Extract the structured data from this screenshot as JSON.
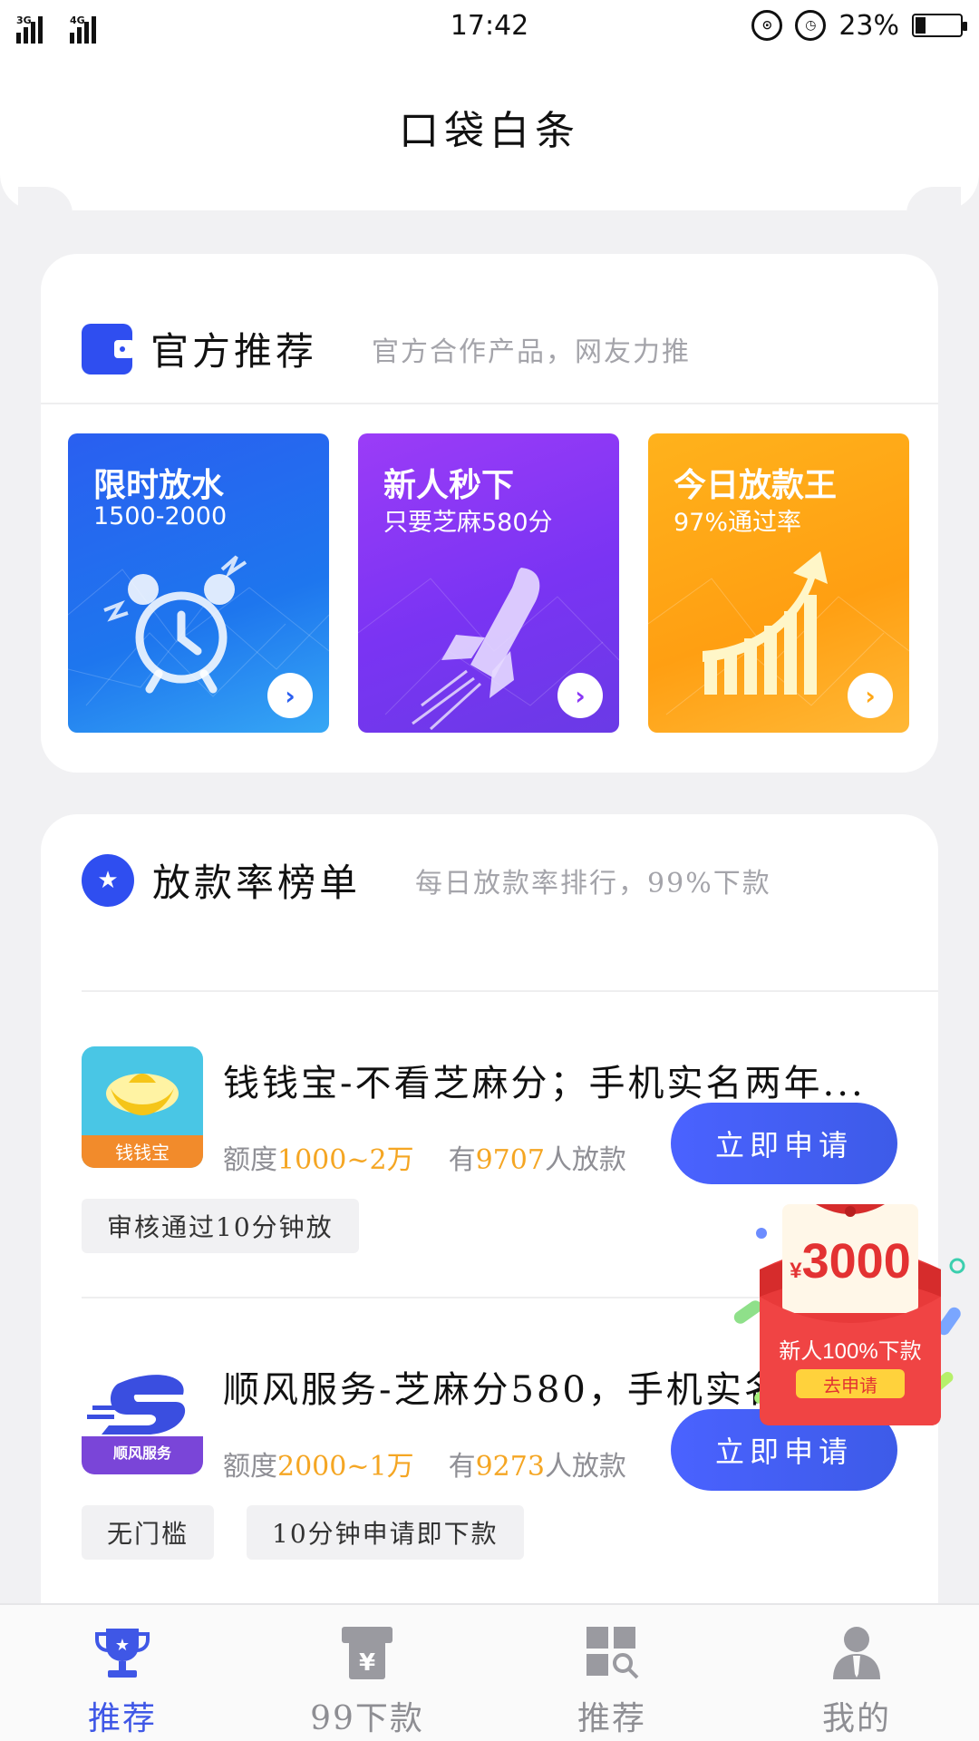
{
  "status_bar": {
    "network_1": "3G",
    "network_2": "4G",
    "time": "17:42",
    "battery_percent": "23%",
    "battery_level": 0.23
  },
  "header": {
    "title": "口袋白条"
  },
  "official": {
    "title": "官方推荐",
    "subtitle": "官方合作产品，网友力推",
    "tiles": [
      {
        "title": "限时放水",
        "subtitle": "1500-2000",
        "color": "#2a5ff0",
        "icon": "alarm-clock-icon"
      },
      {
        "title": "新人秒下",
        "subtitle": "只要芝麻580分",
        "color": "#8a37f5",
        "icon": "rocket-icon"
      },
      {
        "title": "今日放款王",
        "subtitle": "97%通过率",
        "color": "#ffa716",
        "icon": "growth-chart-icon"
      }
    ]
  },
  "ranking": {
    "title": "放款率榜单",
    "subtitle": "每日放款率排行，99%下款",
    "loans": [
      {
        "name": "钱钱宝-不看芝麻分；手机实名两年...",
        "icon_label": "钱钱宝",
        "limit_prefix": "额度",
        "limit": "1000~2万",
        "count_prefix": "有",
        "count": "9707",
        "count_suffix": "人放款",
        "button": "立即申请",
        "tags": [
          "审核通过10分钟放"
        ]
      },
      {
        "name": "顺风服务-芝麻分580，手机实名...",
        "icon_label": "顺风服务",
        "limit_prefix": "额度",
        "limit": "2000~1万",
        "count_prefix": "有",
        "count": "9273",
        "count_suffix": "人放款",
        "button": "立即申请",
        "tags": [
          "无门槛",
          "10分钟申请即下款"
        ]
      }
    ]
  },
  "red_packet": {
    "currency": "¥",
    "amount": "3000",
    "text": "新人100%下款",
    "button": "去申请"
  },
  "bottom_nav": [
    {
      "label": "推荐",
      "icon": "trophy-icon",
      "active": true
    },
    {
      "label": "99下款",
      "icon": "atm-icon",
      "active": false
    },
    {
      "label": "推荐",
      "icon": "grid-search-icon",
      "active": false
    },
    {
      "label": "我的",
      "icon": "user-icon",
      "active": false
    }
  ],
  "colors": {
    "accent": "#3f57e6",
    "highlight": "#f5a623",
    "background": "#f1f1f3"
  }
}
